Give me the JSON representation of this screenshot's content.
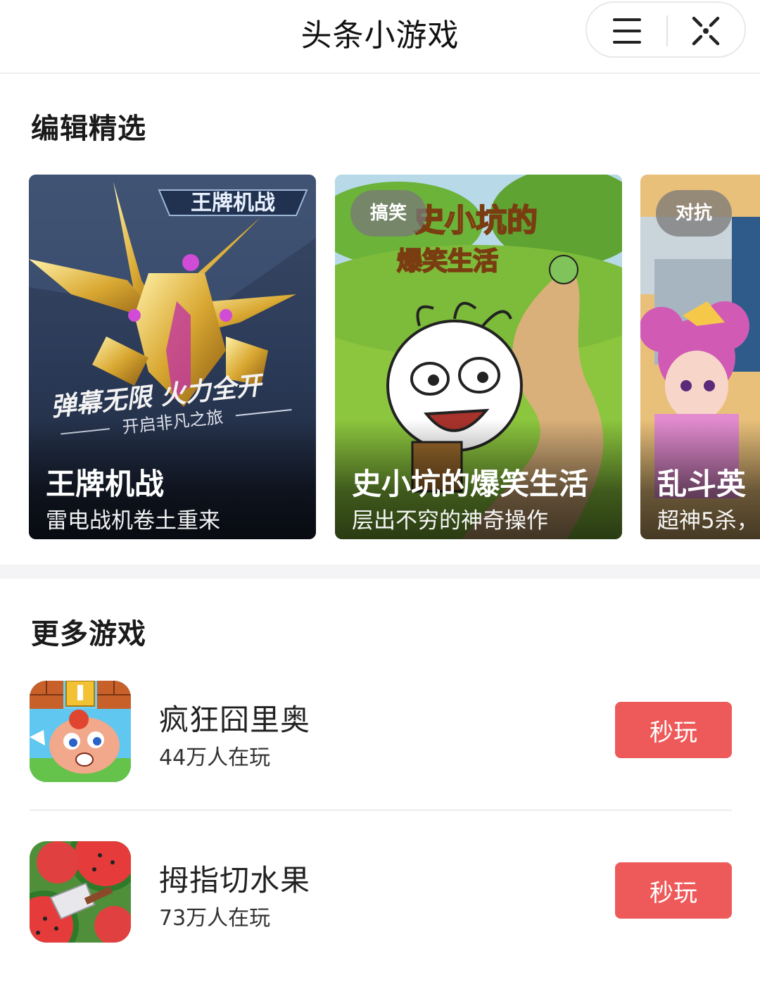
{
  "header": {
    "title": "头条小游戏",
    "menu_icon": "menu-icon",
    "close_icon": "close-icon"
  },
  "featured": {
    "heading": "编辑精选",
    "cards": [
      {
        "name": "王牌机战",
        "description": "雷电战机卷土重来",
        "tag": "",
        "art_logo": "王牌机战",
        "art_slogan": "弹幕无限 火力全开",
        "art_sub": "开启非凡之旅"
      },
      {
        "name": "史小坑的爆笑生活",
        "description": "层出不穷的神奇操作",
        "tag": "搞笑",
        "art_logo_line1": "史小坑的",
        "art_logo_line2": "爆笑生活"
      },
      {
        "name": "乱斗英",
        "description": "超神5杀，",
        "tag": "对抗"
      }
    ]
  },
  "more_games": {
    "heading": "更多游戏",
    "items": [
      {
        "name": "疯狂囧里奥",
        "players": "44万人在玩",
        "button": "秒玩",
        "icon": "mario-style-game-icon"
      },
      {
        "name": "拇指切水果",
        "players": "73万人在玩",
        "button": "秒玩",
        "icon": "watermelon-game-icon"
      }
    ]
  },
  "colors": {
    "play_button": "#ee5a5a",
    "divider": "#ececec"
  }
}
